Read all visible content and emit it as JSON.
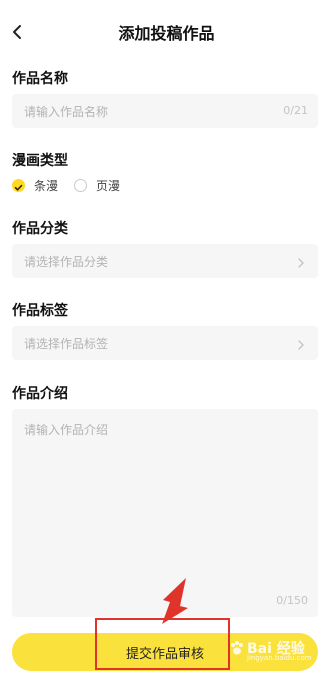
{
  "header": {
    "title": "添加投稿作品"
  },
  "name_section": {
    "label": "作品名称",
    "placeholder": "请输入作品名称",
    "counter": "0/21"
  },
  "type_section": {
    "label": "漫画类型",
    "options": [
      {
        "label": "条漫",
        "selected": true
      },
      {
        "label": "页漫",
        "selected": false
      }
    ]
  },
  "category_section": {
    "label": "作品分类",
    "placeholder": "请选择作品分类"
  },
  "tag_section": {
    "label": "作品标签",
    "placeholder": "请选择作品标签"
  },
  "intro_section": {
    "label": "作品介绍",
    "placeholder": "请输入作品介绍",
    "counter": "0/150"
  },
  "submit": {
    "label": "提交作品审核"
  },
  "watermark": {
    "brand": "Bai 经验",
    "domain": "jingyan.baidu.com"
  },
  "colors": {
    "accent": "#ffd81f",
    "button": "#fbe13c",
    "annotation": "#e0342a"
  },
  "icons": [
    "back-chevron-icon",
    "chevron-right-icon",
    "check-icon"
  ]
}
